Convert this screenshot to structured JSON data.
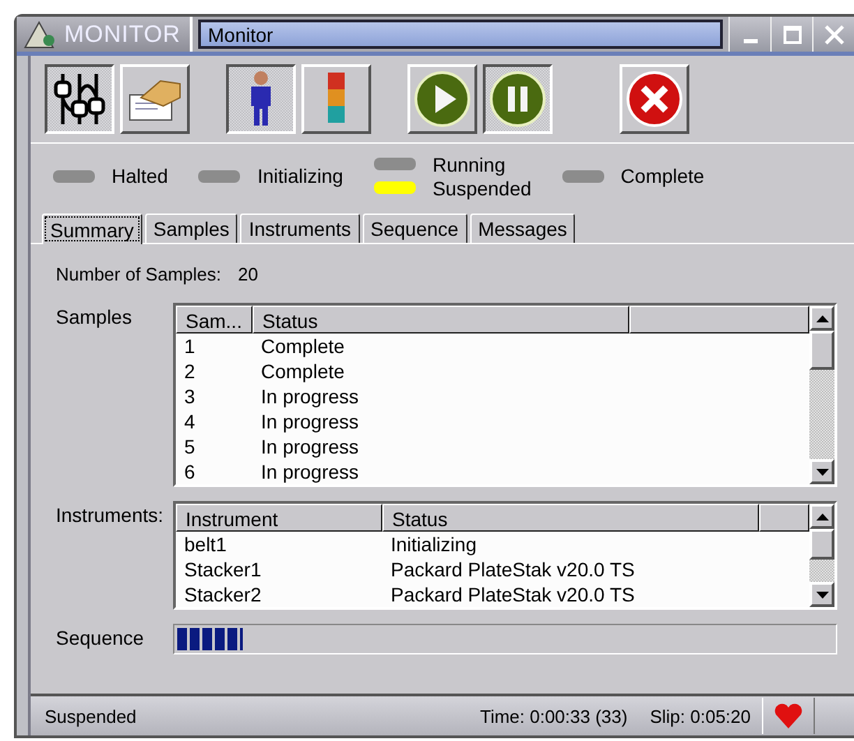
{
  "window": {
    "app_name": "MONITOR",
    "title": "Monitor"
  },
  "toolbar": {
    "buttons": [
      {
        "kind": "switches",
        "pressed": true
      },
      {
        "kind": "document",
        "pressed": false
      },
      {
        "kind": "person",
        "pressed": true
      },
      {
        "kind": "stacklight",
        "pressed": false
      },
      {
        "kind": "play",
        "pressed": false
      },
      {
        "kind": "pause",
        "pressed": true
      },
      {
        "kind": "stop",
        "pressed": false
      }
    ]
  },
  "indicators": [
    {
      "label": "Halted",
      "on": false
    },
    {
      "label": "Initializing",
      "on": false
    },
    {
      "label": "Running",
      "on": false
    },
    {
      "label": "Suspended",
      "on": true
    },
    {
      "label": "Complete",
      "on": false
    }
  ],
  "tabs": [
    {
      "label": "Summary",
      "selected": true
    },
    {
      "label": "Samples",
      "selected": false
    },
    {
      "label": "Instruments",
      "selected": false
    },
    {
      "label": "Sequence",
      "selected": false
    },
    {
      "label": "Messages",
      "selected": false
    }
  ],
  "summary": {
    "count_label": "Number of Samples:",
    "count_value": "20",
    "samples": {
      "label": "Samples",
      "columns": [
        "Sam...",
        "Status"
      ],
      "rows": [
        [
          "1",
          "Complete"
        ],
        [
          "2",
          "Complete"
        ],
        [
          "3",
          "In progress"
        ],
        [
          "4",
          "In progress"
        ],
        [
          "5",
          "In progress"
        ],
        [
          "6",
          "In progress"
        ]
      ]
    },
    "instruments": {
      "label": "Instruments:",
      "columns": [
        "Instrument",
        "Status"
      ],
      "rows": [
        [
          "belt1",
          "Initializing"
        ],
        [
          "Stacker1",
          "Packard PlateStak v20.0 TS"
        ],
        [
          "Stacker2",
          "Packard PlateStak v20.0 TS"
        ]
      ]
    },
    "sequence": {
      "label": "Sequence",
      "level": 0.1
    }
  },
  "status_bar": {
    "state": "Suspended",
    "time": "Time: 0:00:33 (33)",
    "slip": "Slip: 0:05:20"
  }
}
